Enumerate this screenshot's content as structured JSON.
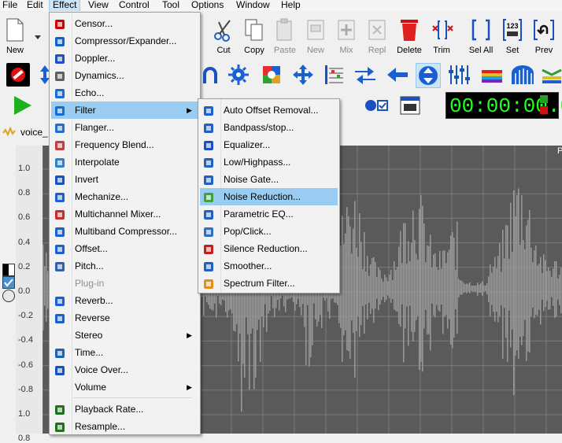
{
  "menubar": [
    "File",
    "Edit",
    "Effect",
    "View",
    "Control",
    "Tool",
    "Options",
    "Window",
    "Help"
  ],
  "toolbar": {
    "new": "New",
    "cut": "Cut",
    "copy": "Copy",
    "paste": "Paste",
    "new2": "New",
    "mix": "Mix",
    "repl": "Repl",
    "delete": "Delete",
    "trim": "Trim",
    "sel_all": "Sel All",
    "set": "Set",
    "prev": "Prev",
    "set_icon_text": "123"
  },
  "time_display": "00:00:00.0",
  "file_tab": "voice_",
  "axis_labels": [
    "1.0",
    "0.8",
    "0.6",
    "0.4",
    "0.2",
    "0.0",
    "-0.2",
    "-0.4",
    "-0.6",
    "-0.8",
    "1.0",
    "0.8"
  ],
  "effect_menu": [
    {
      "label": "Censor...",
      "icon": "censor-icon",
      "color": "#d00000"
    },
    {
      "label": "Compressor/Expander...",
      "icon": "compressor-icon",
      "color": "#1060d0"
    },
    {
      "label": "Doppler...",
      "icon": "doppler-icon",
      "color": "#2050c0"
    },
    {
      "label": "Dynamics...",
      "icon": "dynamics-icon",
      "color": "#606060"
    },
    {
      "label": "Echo...",
      "icon": "echo-icon",
      "color": "#1a6ad8"
    },
    {
      "label": "Filter",
      "icon": "filter-icon",
      "color": "#1a6ad8",
      "submenu": true
    },
    {
      "label": "Flanger...",
      "icon": "flanger-icon",
      "color": "#2070d0"
    },
    {
      "label": "Frequency Blend...",
      "icon": "frequency-blend-icon",
      "color": "#c04040"
    },
    {
      "label": "Interpolate",
      "icon": "interpolate-icon",
      "color": "#3080d0"
    },
    {
      "label": "Invert",
      "icon": "invert-icon",
      "color": "#1a50c0"
    },
    {
      "label": "Mechanize...",
      "icon": "mechanize-icon",
      "color": "#1a60d0"
    },
    {
      "label": "Multichannel Mixer...",
      "icon": "multichannel-mixer-icon",
      "color": "#c03030"
    },
    {
      "label": "Multiband Compressor...",
      "icon": "multiband-compressor-icon",
      "color": "#1a60d0"
    },
    {
      "label": "Offset...",
      "icon": "offset-icon",
      "color": "#1a60d0"
    },
    {
      "label": "Pitch...",
      "icon": "pitch-icon",
      "color": "#3060b0"
    },
    {
      "label": "Plug-in",
      "icon": "",
      "color": "",
      "disabled": true
    },
    {
      "label": "Reverb...",
      "icon": "reverb-icon",
      "color": "#1a60d0"
    },
    {
      "label": "Reverse",
      "icon": "reverse-icon",
      "color": "#1a60d0"
    },
    {
      "label": "Stereo",
      "icon": "",
      "color": "",
      "submenu": true
    },
    {
      "label": "Time...",
      "icon": "time-icon",
      "color": "#2060b0"
    },
    {
      "label": "Voice Over...",
      "icon": "voice-over-icon",
      "color": "#1a50c0"
    },
    {
      "label": "Volume",
      "icon": "",
      "color": "",
      "submenu": true
    },
    {
      "label": "Playback Rate...",
      "icon": "playback-rate-icon",
      "color": "#207020",
      "sep_before": true
    },
    {
      "label": "Resample...",
      "icon": "resample-icon",
      "color": "#207020"
    }
  ],
  "filter_menu": [
    {
      "label": "Auto Offset Removal...",
      "icon": "auto-offset-icon",
      "color": "#1a60d0"
    },
    {
      "label": "Bandpass/stop...",
      "icon": "bandpass-icon",
      "color": "#2060c0"
    },
    {
      "label": "Equalizer...",
      "icon": "equalizer-icon",
      "color": "#1a50c0"
    },
    {
      "label": "Low/Highpass...",
      "icon": "lowhighpass-icon",
      "color": "#2060c0"
    },
    {
      "label": "Noise Gate...",
      "icon": "noise-gate-icon",
      "color": "#2060c0"
    },
    {
      "label": "Noise Reduction...",
      "icon": "noise-reduction-icon",
      "color": "#40a040",
      "highlighted": true
    },
    {
      "label": "Parametric EQ...",
      "icon": "parametric-eq-icon",
      "color": "#2060c0"
    },
    {
      "label": "Pop/Click...",
      "icon": "pop-click-icon",
      "color": "#3070c0"
    },
    {
      "label": "Silence Reduction...",
      "icon": "silence-reduction-icon",
      "color": "#c02020"
    },
    {
      "label": "Smoother...",
      "icon": "smoother-icon",
      "color": "#2060c0"
    },
    {
      "label": "Spectrum Filter...",
      "icon": "spectrum-filter-icon",
      "color": "#e09020"
    }
  ],
  "colors": {
    "accent": "#99ccf0",
    "waveform": "#9a9a9a",
    "wave_bg": "#5a5a5a",
    "time_green": "#22ff22"
  }
}
